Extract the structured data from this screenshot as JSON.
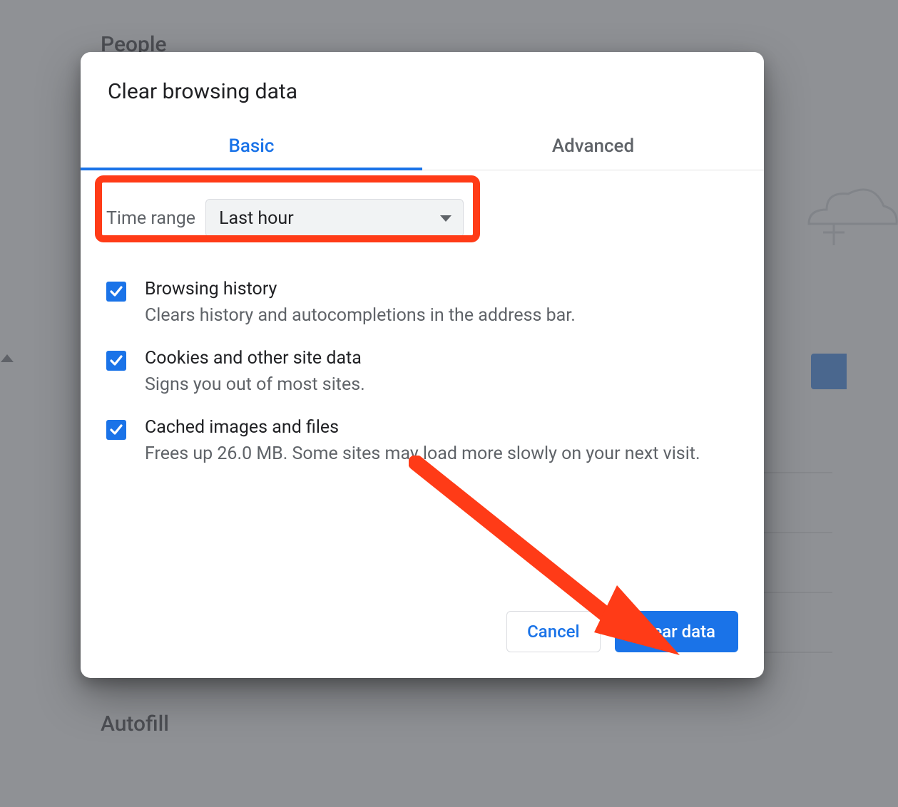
{
  "background": {
    "section_people": "People",
    "section_autofill": "Autofill"
  },
  "dialog": {
    "title": "Clear browsing data",
    "tabs": {
      "basic": "Basic",
      "advanced": "Advanced"
    },
    "time_range": {
      "label": "Time range",
      "selected": "Last hour"
    },
    "options": [
      {
        "title": "Browsing history",
        "desc": "Clears history and autocompletions in the address bar.",
        "checked": true
      },
      {
        "title": "Cookies and other site data",
        "desc": "Signs you out of most sites.",
        "checked": true
      },
      {
        "title": "Cached images and files",
        "desc": "Frees up 26.0 MB. Some sites may load more slowly on your next visit.",
        "checked": true
      }
    ],
    "buttons": {
      "cancel": "Cancel",
      "clear": "Clear data"
    }
  },
  "annotation": {
    "highlight_color": "#ff3b17",
    "arrow_color": "#ff3b17"
  }
}
